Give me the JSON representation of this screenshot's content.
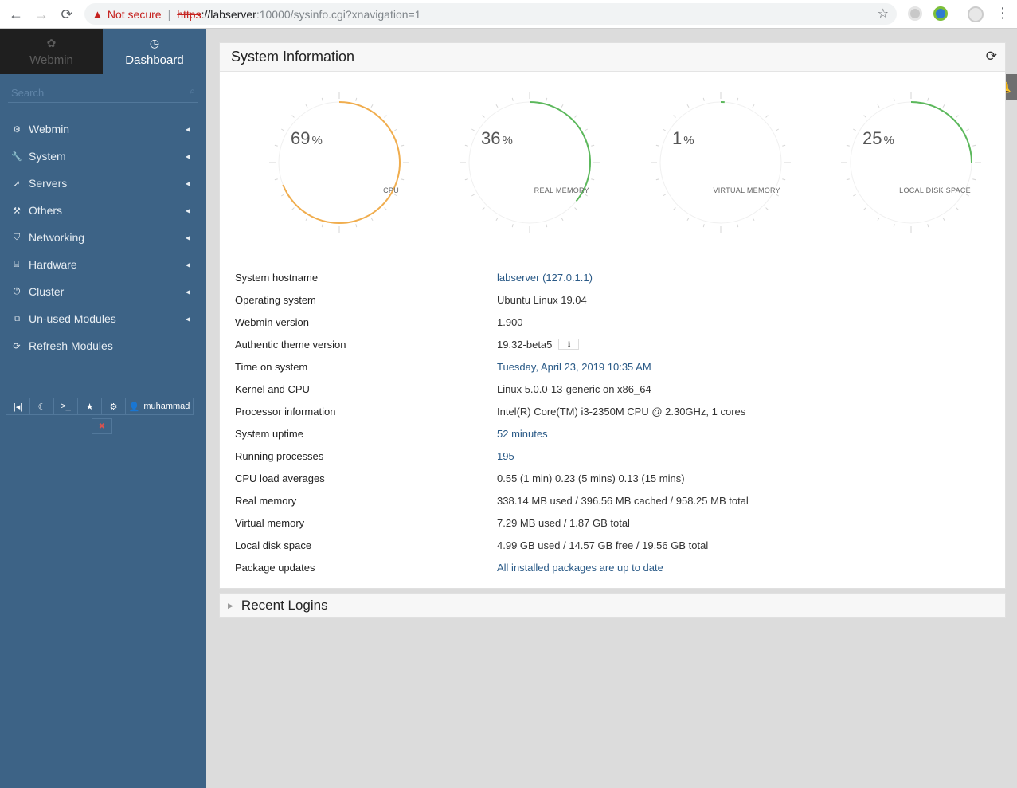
{
  "browser": {
    "not_secure": "Not secure",
    "url_proto": "https",
    "url_host": "://labserver",
    "url_rest": ":10000/sysinfo.cgi?xnavigation=1"
  },
  "sidebar": {
    "tabs": [
      {
        "label": "Webmin",
        "icon": "webmin-logo-icon"
      },
      {
        "label": "Dashboard",
        "icon": "dashboard-icon"
      }
    ],
    "search_placeholder": "Search",
    "items": [
      {
        "label": "Webmin",
        "icon": "gear-icon",
        "glyph": "⚙"
      },
      {
        "label": "System",
        "icon": "wrench-icon",
        "glyph": "🔧"
      },
      {
        "label": "Servers",
        "icon": "rocket-icon",
        "glyph": "➚"
      },
      {
        "label": "Others",
        "icon": "hammer-icon",
        "glyph": "⚒"
      },
      {
        "label": "Networking",
        "icon": "shield-icon",
        "glyph": "⛉"
      },
      {
        "label": "Hardware",
        "icon": "hdd-icon",
        "glyph": "⌸"
      },
      {
        "label": "Cluster",
        "icon": "power-icon",
        "glyph": "⏻"
      },
      {
        "label": "Un-used Modules",
        "icon": "puzzle-icon",
        "glyph": "⧉"
      },
      {
        "label": "Refresh Modules",
        "icon": "refresh-icon",
        "glyph": "⟳"
      }
    ],
    "username": "muhammad"
  },
  "panel": {
    "title": "System Information",
    "gauges": [
      {
        "value": "69",
        "unit": "%",
        "label": "CPU",
        "percent": 69,
        "color": "#f0ad4e"
      },
      {
        "value": "36",
        "unit": "%",
        "label": "REAL MEMORY",
        "percent": 36,
        "color": "#5cb85c"
      },
      {
        "value": "1",
        "unit": "%",
        "label": "VIRTUAL MEMORY",
        "percent": 1,
        "color": "#5cb85c"
      },
      {
        "value": "25",
        "unit": "%",
        "label": "LOCAL DISK SPACE",
        "percent": 25,
        "color": "#5cb85c"
      }
    ],
    "rows": [
      {
        "key": "System hostname",
        "value": "labserver (127.0.1.1)",
        "link": true
      },
      {
        "key": "Operating system",
        "value": "Ubuntu Linux 19.04",
        "link": false
      },
      {
        "key": "Webmin version",
        "value": "1.900",
        "link": false
      },
      {
        "key": "Authentic theme version",
        "value": "19.32-beta5",
        "link": false
      },
      {
        "key": "Time on system",
        "value": "Tuesday, April 23, 2019 10:35 AM",
        "link": true
      },
      {
        "key": "Kernel and CPU",
        "value": "Linux 5.0.0-13-generic on x86_64",
        "link": false
      },
      {
        "key": "Processor information",
        "value": "Intel(R) Core(TM) i3-2350M CPU @ 2.30GHz, 1 cores",
        "link": false
      },
      {
        "key": "System uptime",
        "value": "52 minutes",
        "link": true
      },
      {
        "key": "Running processes",
        "value": "195",
        "link": true
      },
      {
        "key": "CPU load averages",
        "value": "0.55 (1 min) 0.23 (5 mins) 0.13 (15 mins)",
        "link": false
      },
      {
        "key": "Real memory",
        "value": "338.14 MB used / 396.56 MB cached / 958.25 MB total",
        "link": false
      },
      {
        "key": "Virtual memory",
        "value": "7.29 MB used / 1.87 GB total",
        "link": false
      },
      {
        "key": "Local disk space",
        "value": "4.99 GB used / 14.57 GB free / 19.56 GB total",
        "link": false
      },
      {
        "key": "Package updates",
        "value": "All installed packages are up to date",
        "link": true
      }
    ]
  },
  "recent_logins": {
    "title": "Recent Logins"
  }
}
